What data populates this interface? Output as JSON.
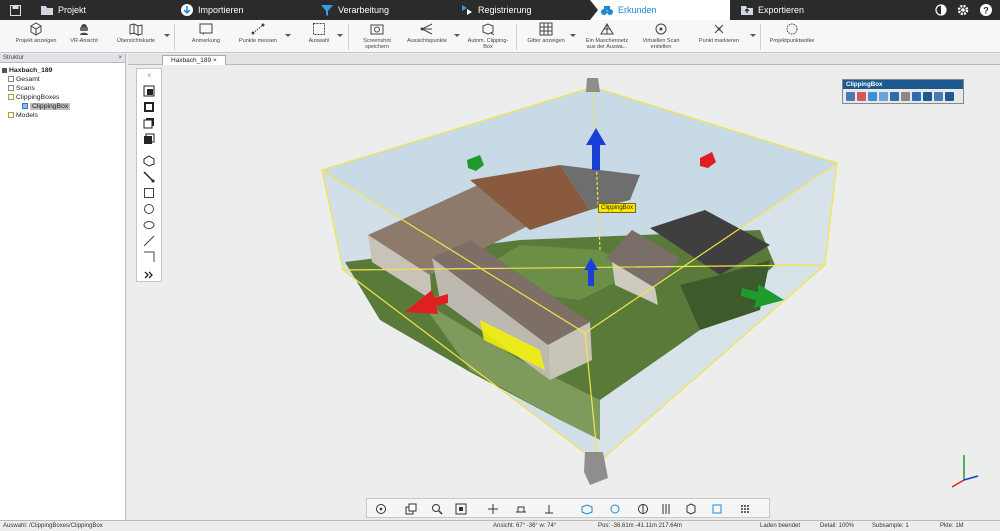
{
  "ribbon": {
    "tabs": [
      {
        "label": "Projekt"
      },
      {
        "label": "Importieren"
      },
      {
        "label": "Verarbeitung"
      },
      {
        "label": "Registrierung"
      },
      {
        "label": "Erkunden"
      },
      {
        "label": "Exportieren"
      }
    ],
    "active_tab": "Erkunden",
    "accent": "#1a8ad6"
  },
  "toolbar": {
    "items": [
      {
        "label": "Projekt anzeigen"
      },
      {
        "label": "VR-Ansicht"
      },
      {
        "label": "Übersichtskarte"
      },
      {
        "label": "Anmerkung"
      },
      {
        "label": "Punkte messen"
      },
      {
        "label": "Auswahl"
      },
      {
        "label": "Screenshot speichern"
      },
      {
        "label": "Aussichtspunkte"
      },
      {
        "label": "Autom. Clipping-Box"
      },
      {
        "label": "Gitter anzeigen"
      },
      {
        "label": "Ein Maschennetz aus der Auswa..."
      },
      {
        "label": "Virtuellen Scan erstellen"
      },
      {
        "label": "Punkt markieren"
      },
      {
        "label": "Projektpunktwolke"
      }
    ]
  },
  "structure_panel": {
    "title": "Struktur",
    "root": "Haxbach_189",
    "nodes": [
      {
        "label": "Gesamt"
      },
      {
        "label": "Scans"
      },
      {
        "label": "ClippingBoxes"
      },
      {
        "label": "ClippingBox"
      },
      {
        "label": "Models"
      }
    ]
  },
  "view_tab": {
    "label": "Haxbach_189"
  },
  "clipping_panel": {
    "title": "ClippingBox"
  },
  "label_3d": "ClippingBox",
  "status": {
    "path": "Auswahl: /ClippingBoxes/ClippingBox",
    "view": "Ansicht: 67° -36° w: 74°",
    "pos": "Pos: -36.61m -41.11m 217.64m",
    "load": "Laden beendet",
    "detail": "Detail: 100%",
    "subsample": "Subsample: 1",
    "pts": "Pkte: 1M"
  },
  "colors": {
    "box": "#f2e44a",
    "red_arrow": "#e02020",
    "green_arrow": "#1e9a2e",
    "blue_arrow": "#1a3fd6"
  }
}
